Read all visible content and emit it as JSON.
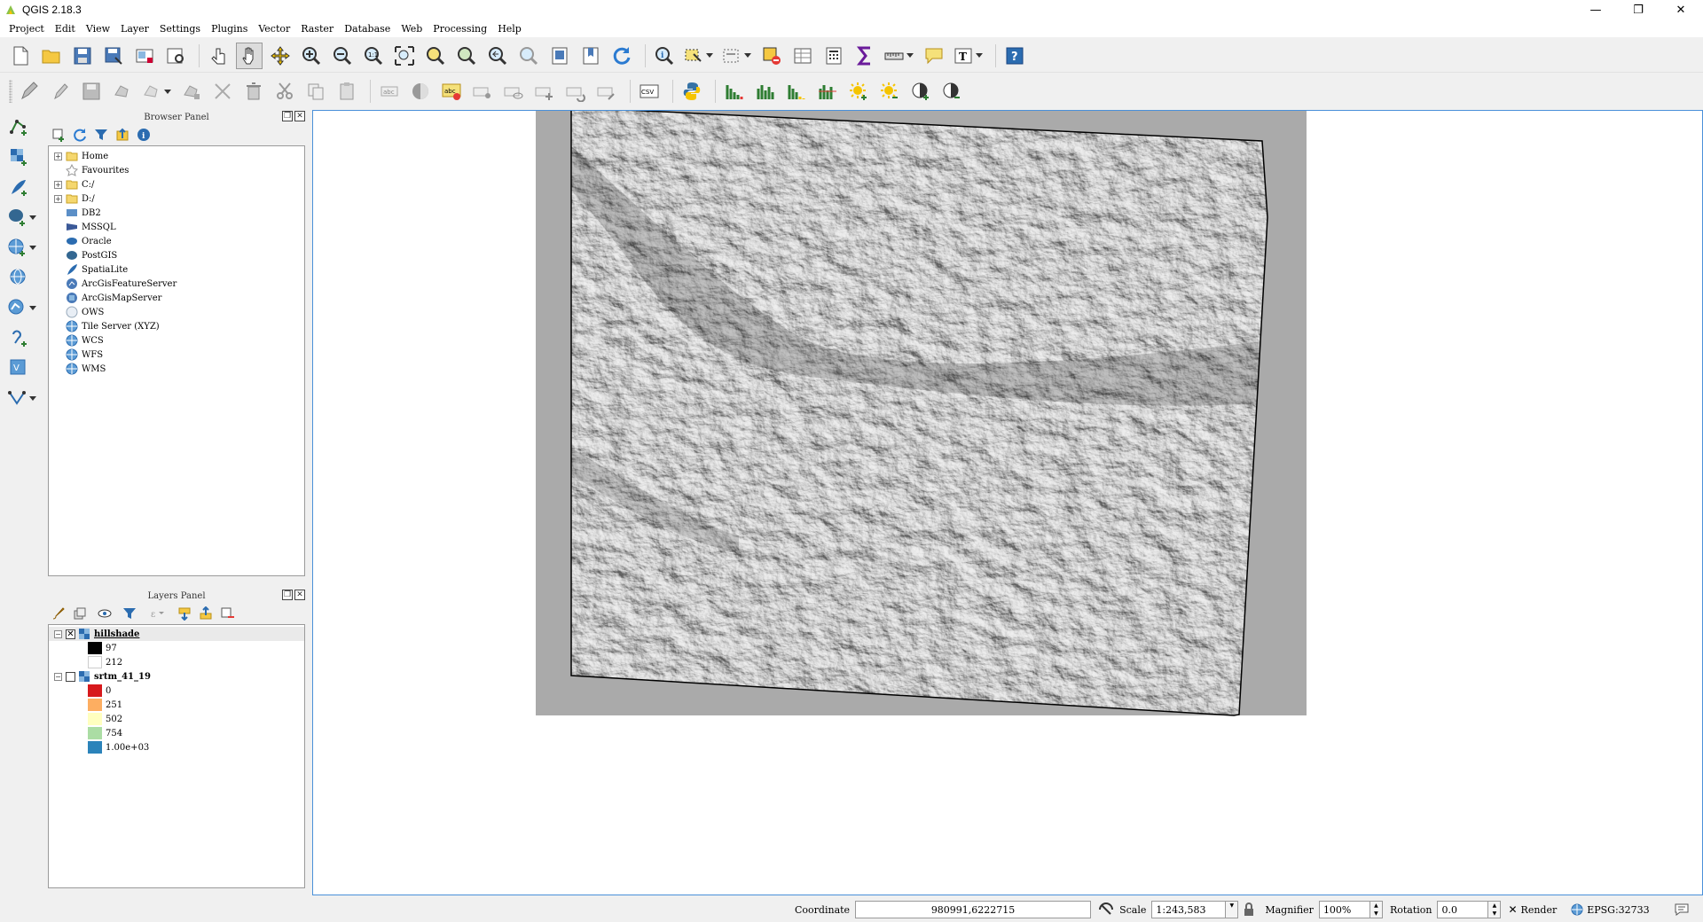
{
  "window": {
    "title": "QGIS 2.18.3",
    "controls": {
      "minimize": "—",
      "restore": "❐",
      "close": "✕"
    }
  },
  "menu": [
    "Project",
    "Edit",
    "View",
    "Layer",
    "Settings",
    "Plugins",
    "Vector",
    "Raster",
    "Database",
    "Web",
    "Processing",
    "Help"
  ],
  "browser_panel": {
    "title": "Browser Panel",
    "items": [
      {
        "label": "Home",
        "icon": "folder-icon",
        "expandable": true
      },
      {
        "label": "Favourites",
        "icon": "star-icon",
        "expandable": false
      },
      {
        "label": "C:/",
        "icon": "folder-icon",
        "expandable": true
      },
      {
        "label": "D:/",
        "icon": "folder-icon",
        "expandable": true
      },
      {
        "label": "DB2",
        "icon": "db2-icon",
        "expandable": false
      },
      {
        "label": "MSSQL",
        "icon": "mssql-icon",
        "expandable": false
      },
      {
        "label": "Oracle",
        "icon": "oracle-icon",
        "expandable": false
      },
      {
        "label": "PostGIS",
        "icon": "postgis-icon",
        "expandable": false
      },
      {
        "label": "SpatiaLite",
        "icon": "spatialite-icon",
        "expandable": false
      },
      {
        "label": "ArcGisFeatureServer",
        "icon": "arcgis-feature-icon",
        "expandable": false
      },
      {
        "label": "ArcGisMapServer",
        "icon": "arcgis-map-icon",
        "expandable": false
      },
      {
        "label": "OWS",
        "icon": "ows-icon",
        "expandable": false
      },
      {
        "label": "Tile Server (XYZ)",
        "icon": "globe-icon",
        "expandable": false
      },
      {
        "label": "WCS",
        "icon": "globe-icon",
        "expandable": false
      },
      {
        "label": "WFS",
        "icon": "globe-icon",
        "expandable": false
      },
      {
        "label": "WMS",
        "icon": "globe-icon",
        "expandable": false
      }
    ]
  },
  "layers_panel": {
    "title": "Layers Panel",
    "layers": [
      {
        "name": "hillshade",
        "checked": true,
        "check_mark": "✕",
        "legend": [
          {
            "label": "97",
            "color": "#000000"
          },
          {
            "label": "212",
            "color": "#ffffff"
          }
        ]
      },
      {
        "name": "srtm_41_19",
        "checked": false,
        "check_mark": "",
        "legend": [
          {
            "label": "0",
            "color": "#d7191c"
          },
          {
            "label": "251",
            "color": "#fdae61"
          },
          {
            "label": "502",
            "color": "#ffffbf"
          },
          {
            "label": "754",
            "color": "#abdda4"
          },
          {
            "label": "1.00e+03",
            "color": "#2b83ba"
          }
        ]
      }
    ]
  },
  "status": {
    "coordinate_label": "Coordinate",
    "coordinate_value": "980991,6222715",
    "scale_label": "Scale",
    "scale_value": "1:243,583",
    "magnifier_label": "Magnifier",
    "magnifier_value": "100%",
    "rotation_label": "Rotation",
    "rotation_value": "0.0",
    "render_label": "Render",
    "render_checked": true,
    "crs": "EPSG:32733"
  },
  "colors": {
    "map_border": "#4a90d9",
    "nodata_gray": "#aaaaaa",
    "accent_blue": "#2b6cb0"
  }
}
